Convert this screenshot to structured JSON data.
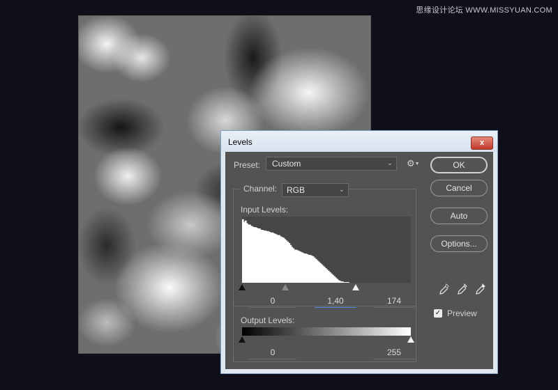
{
  "watermark": "思缘设计论坛  WWW.MISSYUAN.COM",
  "dialog": {
    "title": "Levels",
    "close_glyph": "x",
    "preset_label": "Preset:",
    "preset_value": "Custom",
    "channel_label": "Channel:",
    "channel_value": "RGB",
    "input_levels_label": "Input Levels:",
    "input_values": {
      "black": "0",
      "gamma": "1,40",
      "white": "174"
    },
    "output_levels_label": "Output Levels:",
    "output_values": {
      "black": "0",
      "white": "255"
    },
    "buttons": {
      "ok": "OK",
      "cancel": "Cancel",
      "auto": "Auto",
      "options": "Options..."
    },
    "preview_label": "Preview",
    "preview_checked": true,
    "input_slider_levels": {
      "black": 0,
      "gamma": 1.4,
      "white": 174
    },
    "output_slider_levels": {
      "black": 0,
      "white": 255
    }
  },
  "histogram": [
    96,
    92,
    94,
    90,
    88,
    88,
    86,
    85,
    84,
    84,
    83,
    82,
    82,
    80,
    80,
    79,
    79,
    78,
    78,
    77,
    76,
    76,
    75,
    74,
    73,
    72,
    72,
    70,
    69,
    68,
    66,
    64,
    62,
    60,
    57,
    54,
    52,
    50,
    50,
    49,
    48,
    47,
    46,
    45,
    44,
    44,
    43,
    42,
    42,
    41,
    40,
    38,
    36,
    34,
    32,
    30,
    28,
    26,
    24,
    22,
    20,
    18,
    16,
    14,
    12,
    10,
    8,
    6,
    4,
    3,
    2,
    2,
    1,
    1,
    1,
    1,
    0,
    0,
    0,
    0,
    0,
    0,
    0,
    0,
    0,
    0,
    0,
    0,
    0,
    0,
    0,
    0,
    0,
    0,
    0,
    0,
    0,
    0,
    0,
    0,
    0,
    0,
    0,
    0,
    0,
    0,
    0,
    0,
    0,
    0,
    0,
    0,
    0,
    0,
    0,
    0,
    0,
    0,
    0,
    0
  ]
}
